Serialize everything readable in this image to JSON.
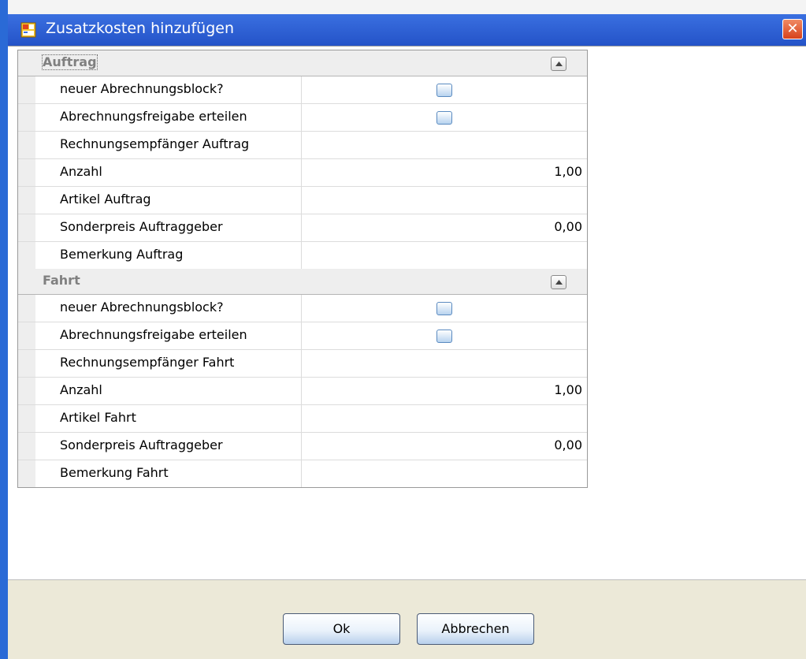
{
  "window": {
    "title": "Zusatzkosten hinzufügen",
    "close_label": "✕"
  },
  "sections": [
    {
      "label": "Auftrag",
      "rows": [
        {
          "label": "neuer Abrechnungsblock?",
          "type": "checkbox",
          "value": ""
        },
        {
          "label": "Abrechnungsfreigabe erteilen",
          "type": "checkbox",
          "value": ""
        },
        {
          "label": "Rechnungsempfänger Auftrag",
          "type": "text",
          "value": ""
        },
        {
          "label": "Anzahl",
          "type": "text",
          "value": "1,00"
        },
        {
          "label": "Artikel Auftrag",
          "type": "text",
          "value": ""
        },
        {
          "label": "Sonderpreis Auftraggeber",
          "type": "text",
          "value": "0,00"
        },
        {
          "label": "Bemerkung Auftrag",
          "type": "text",
          "value": ""
        }
      ]
    },
    {
      "label": "Fahrt",
      "rows": [
        {
          "label": "neuer Abrechnungsblock?",
          "type": "checkbox",
          "value": ""
        },
        {
          "label": "Abrechnungsfreigabe erteilen",
          "type": "checkbox",
          "value": ""
        },
        {
          "label": "Rechnungsempfänger Fahrt",
          "type": "text",
          "value": ""
        },
        {
          "label": "Anzahl",
          "type": "text",
          "value": "1,00"
        },
        {
          "label": "Artikel Fahrt",
          "type": "text",
          "value": ""
        },
        {
          "label": "Sonderpreis Auftraggeber",
          "type": "text",
          "value": "0,00"
        },
        {
          "label": "Bemerkung Fahrt",
          "type": "text",
          "value": ""
        }
      ]
    }
  ],
  "buttons": {
    "ok": "Ok",
    "cancel": "Abbrechen"
  },
  "icons": {
    "app": "app-window-icon",
    "close": "close-icon",
    "collapse": "chevron-up-icon"
  },
  "colors": {
    "titlebar": "#2453c8",
    "close": "#d6411c",
    "category_text": "#808080"
  }
}
